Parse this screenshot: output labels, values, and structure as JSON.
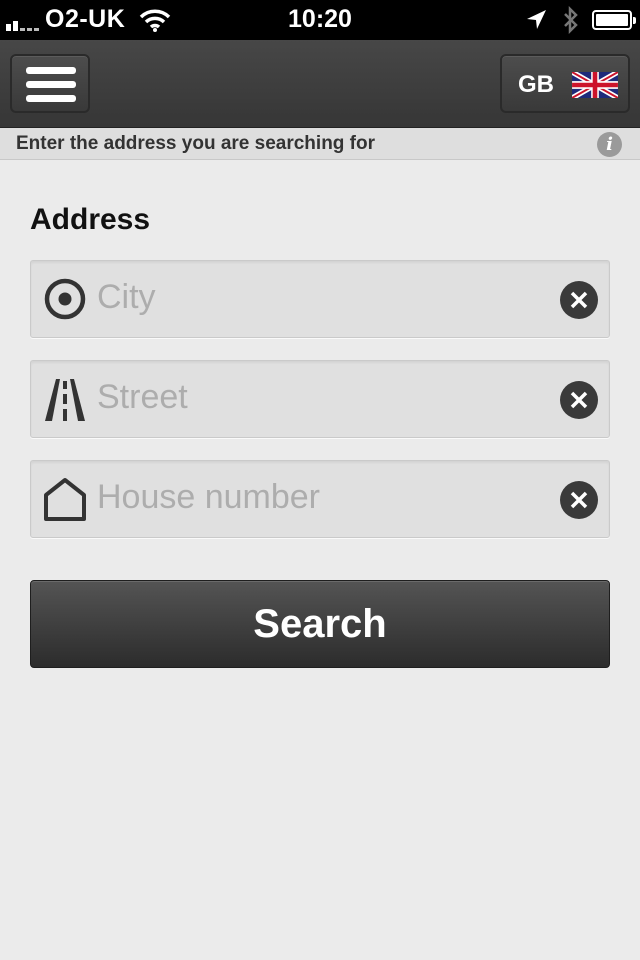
{
  "status_bar": {
    "carrier": "O2-UK",
    "time": "10:20"
  },
  "header": {
    "language_code": "GB",
    "flag_icon": "uk-flag-icon"
  },
  "info_bar": {
    "text": "Enter the address you are searching for",
    "icon": "info-icon"
  },
  "form": {
    "section_title": "Address",
    "fields": [
      {
        "placeholder": "City",
        "icon": "target-icon"
      },
      {
        "placeholder": "Street",
        "icon": "road-icon"
      },
      {
        "placeholder": "House number",
        "icon": "house-icon"
      }
    ],
    "search_label": "Search"
  },
  "colors": {
    "navbar": "#3d3d3d",
    "background": "#ebebeb",
    "field": "#e0e0e0",
    "placeholder": "#adadad",
    "button": "#3a3a3a"
  }
}
